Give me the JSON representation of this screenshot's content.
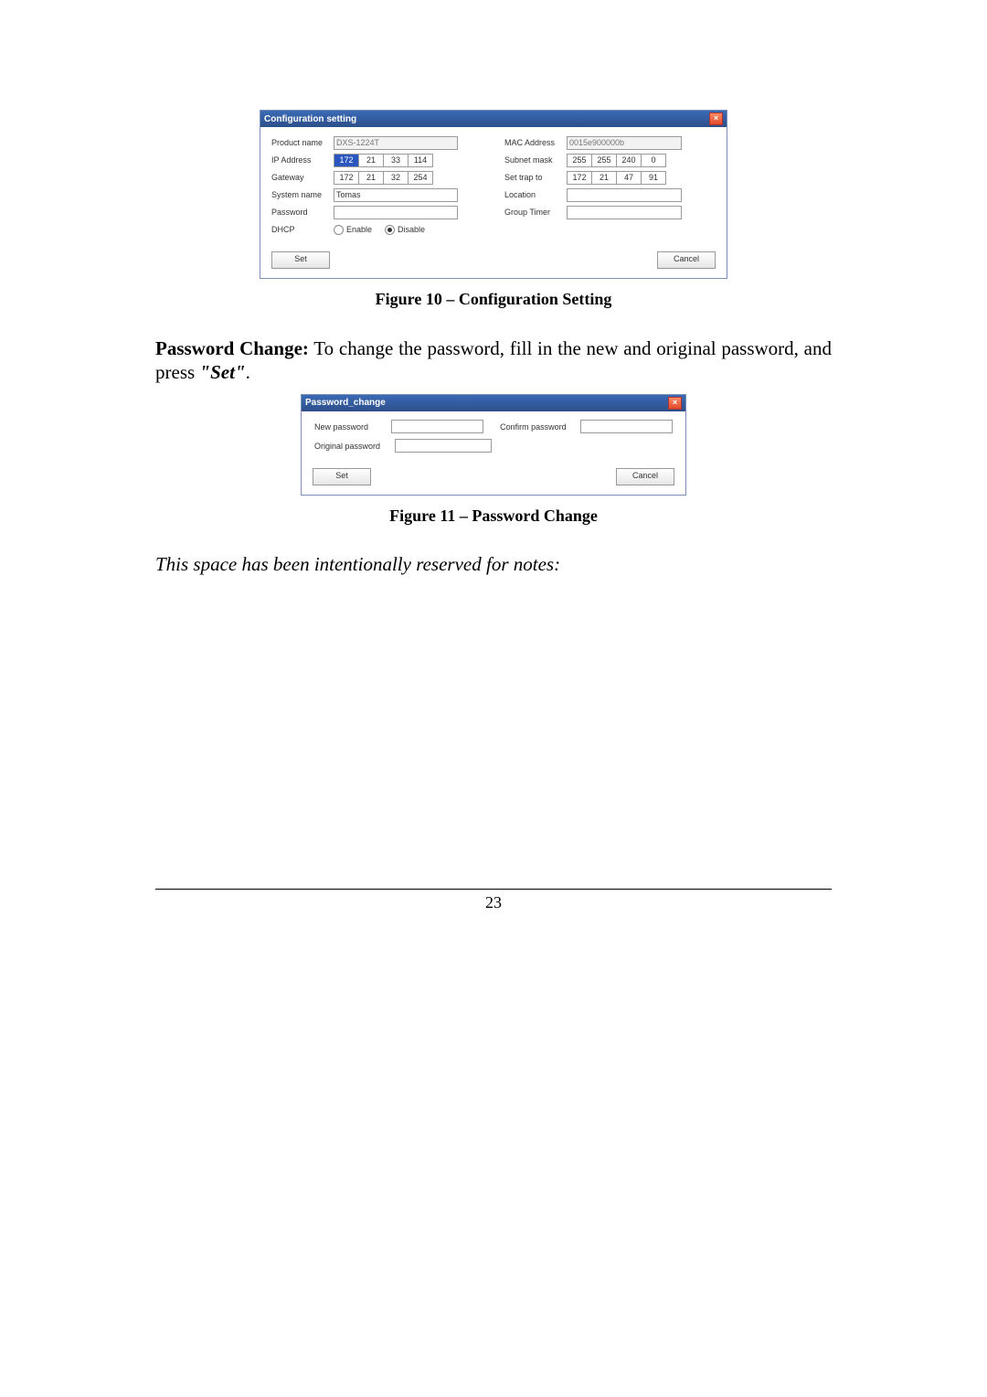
{
  "fig10": {
    "title": "Configuration setting",
    "labels": {
      "product_name": "Product name",
      "ip_address": "IP Address",
      "gateway": "Gateway",
      "system_name": "System name",
      "password": "Password",
      "dhcp": "DHCP",
      "mac_address": "MAC Address",
      "subnet_mask": "Subnet mask",
      "set_trap_to": "Set trap to",
      "location": "Location",
      "group_timer": "Group Timer"
    },
    "values": {
      "product_name": "DXS-1224T",
      "ip": [
        "172",
        "21",
        "33",
        "114"
      ],
      "gateway": [
        "172",
        "21",
        "32",
        "254"
      ],
      "system_name": "Tomas",
      "password": "",
      "mac_address": "0015e900000b",
      "subnet_mask": [
        "255",
        "255",
        "240",
        "0"
      ],
      "set_trap_to": [
        "172",
        "21",
        "47",
        "91"
      ],
      "location": "",
      "group_timer": ""
    },
    "dhcp": {
      "enable": "Enable",
      "disable": "Disable",
      "selected": "disable"
    },
    "buttons": {
      "set": "Set",
      "cancel": "Cancel"
    },
    "caption": "Figure 10 – Configuration Setting"
  },
  "para1": {
    "lead": "Password Change:",
    "rest_a": " To change the password, fill in the new and original password, and press ",
    "set": "\"Set\"",
    "tail": "."
  },
  "fig11": {
    "title": "Password_change",
    "labels": {
      "new_password": "New password",
      "confirm_password": "Confirm password",
      "original_password": "Original password"
    },
    "buttons": {
      "set": "Set",
      "cancel": "Cancel"
    },
    "caption": "Figure 11 – Password Change"
  },
  "notes_line": "This space has been intentionally reserved for notes:",
  "page_number": "23"
}
